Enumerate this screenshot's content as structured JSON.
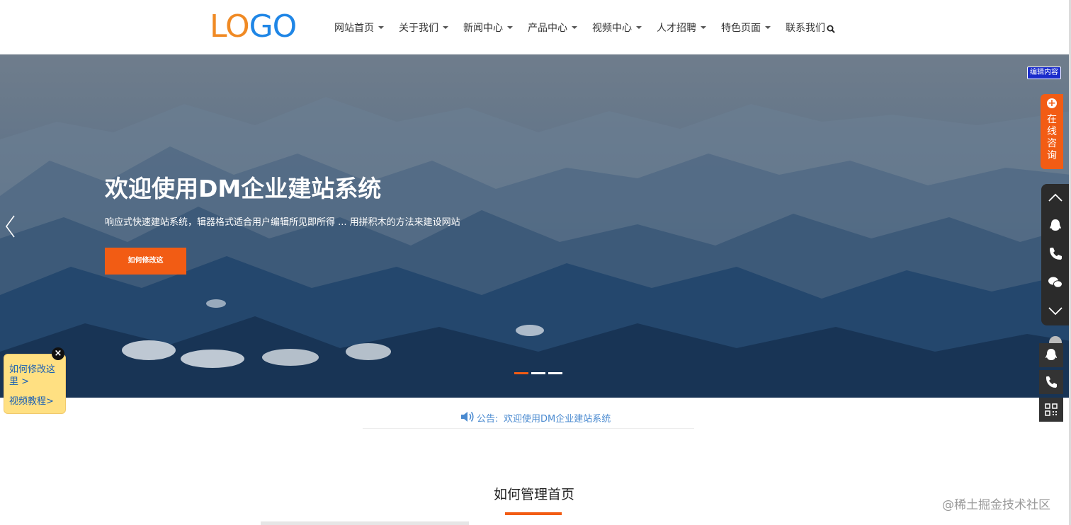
{
  "logo": {
    "part1": "LO",
    "part2": "GO"
  },
  "nav": {
    "items": [
      {
        "label": "网站首页",
        "has_dropdown": true
      },
      {
        "label": "关于我们",
        "has_dropdown": true
      },
      {
        "label": "新闻中心",
        "has_dropdown": true
      },
      {
        "label": "产品中心",
        "has_dropdown": true
      },
      {
        "label": "视频中心",
        "has_dropdown": true
      },
      {
        "label": "人才招聘",
        "has_dropdown": true
      },
      {
        "label": "特色页面",
        "has_dropdown": true
      },
      {
        "label": "联系我们",
        "has_dropdown": false
      }
    ],
    "search_icon": "search-icon"
  },
  "banner": {
    "title": "欢迎使用DM企业建站系统",
    "subtitle": "响应式快速建站系统，辑器格式适合用户编辑所见即所得 ... 用拼积木的方法来建设网站",
    "button": "如何修改这",
    "edit_badge": "编辑内容",
    "slides": 3,
    "active_slide": 1
  },
  "side_widgets": {
    "online_consult": "在线咨询",
    "contact_icons": [
      "chevron-up-icon",
      "qq-icon",
      "phone-icon",
      "wechat-icon",
      "chevron-down-icon"
    ],
    "bottom_icons": [
      "qq-icon",
      "phone-icon",
      "qrcode-icon"
    ]
  },
  "help": {
    "link1": "如何修改这里 >",
    "link2": "视频教程>",
    "close": "×"
  },
  "notice": {
    "label": "公告:",
    "text": "欢迎使用DM企业建站系统"
  },
  "section": {
    "title": "如何管理首页"
  },
  "watermark": "@稀土掘金技术社区",
  "colors": {
    "accent": "#f25c14",
    "logo_orange": "#f08a24",
    "logo_blue": "#1f86e6",
    "link_blue": "#4a8ad0",
    "help_bg": "#ffe082"
  }
}
